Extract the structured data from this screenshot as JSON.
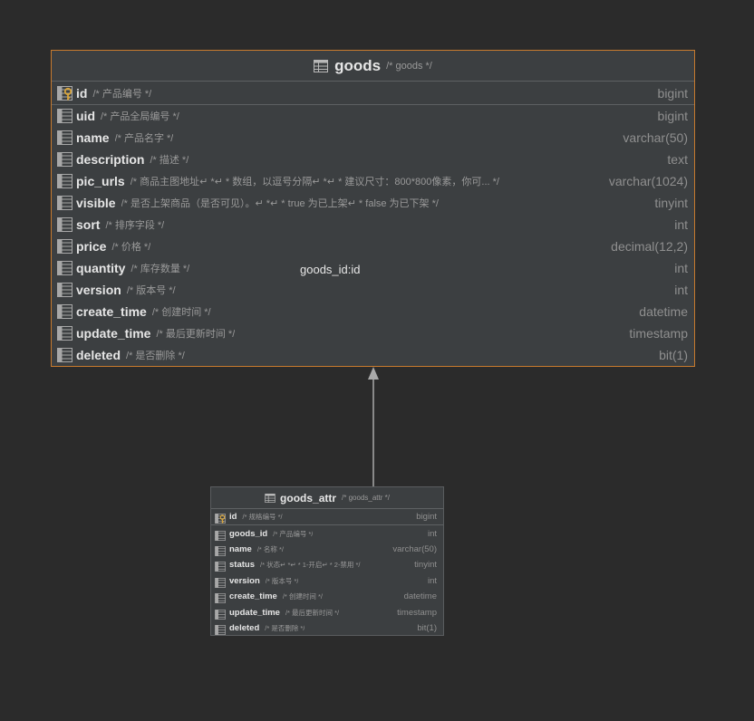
{
  "goods": {
    "name": "goods",
    "comment": "/* goods */",
    "columns": [
      {
        "name": "id",
        "comment": "/* 产品编号 */",
        "type": "bigint",
        "pk": true
      },
      {
        "name": "uid",
        "comment": "/* 产品全局编号 */",
        "type": "bigint"
      },
      {
        "name": "name",
        "comment": "/* 产品名字 */",
        "type": "varchar(50)"
      },
      {
        "name": "description",
        "comment": "/* 描述 */",
        "type": "text"
      },
      {
        "name": "pic_urls",
        "comment": "/* 商品主图地址↵     *↵     * 数组，以逗号分隔↵     *↵     * 建议尺寸：800*800像素，你可... */",
        "type": "varchar(1024)"
      },
      {
        "name": "visible",
        "comment": "/* 是否上架商品（是否可见）。↵     *↵     * true 为已上架↵     * false 为已下架 */",
        "type": "tinyint"
      },
      {
        "name": "sort",
        "comment": "/* 排序字段 */",
        "type": "int"
      },
      {
        "name": "price",
        "comment": "/* 价格 */",
        "type": "decimal(12,2)"
      },
      {
        "name": "quantity",
        "comment": "/* 库存数量 */",
        "type": "int"
      },
      {
        "name": "version",
        "comment": "/* 版本号 */",
        "type": "int"
      },
      {
        "name": "create_time",
        "comment": "/* 创建时间 */",
        "type": "datetime"
      },
      {
        "name": "update_time",
        "comment": "/* 最后更新时间 */",
        "type": "timestamp"
      },
      {
        "name": "deleted",
        "comment": "/* 是否删除 */",
        "type": "bit(1)"
      }
    ]
  },
  "goods_attr": {
    "name": "goods_attr",
    "comment": "/* goods_attr */",
    "columns": [
      {
        "name": "id",
        "comment": "/* 规格编号 */",
        "type": "bigint",
        "pk": true
      },
      {
        "name": "goods_id",
        "comment": "/* 产品编号 */",
        "type": "int"
      },
      {
        "name": "name",
        "comment": "/* 名称 */",
        "type": "varchar(50)"
      },
      {
        "name": "status",
        "comment": "/* 状态↵     *↵     * 1-开启↵     * 2-禁用 */",
        "type": "tinyint"
      },
      {
        "name": "version",
        "comment": "/* 版本号 */",
        "type": "int"
      },
      {
        "name": "create_time",
        "comment": "/* 创建时间 */",
        "type": "datetime"
      },
      {
        "name": "update_time",
        "comment": "/* 最后更新时间 */",
        "type": "timestamp"
      },
      {
        "name": "deleted",
        "comment": "/* 是否删除 */",
        "type": "bit(1)"
      }
    ]
  },
  "relation": {
    "label": "goods_id:id"
  },
  "colors": {
    "background": "#2b2b2b",
    "table_bg": "#3c3f41",
    "selected_border": "#c77a2e",
    "key_gold": "#d9a53a",
    "connector": "#a9a9a9"
  }
}
